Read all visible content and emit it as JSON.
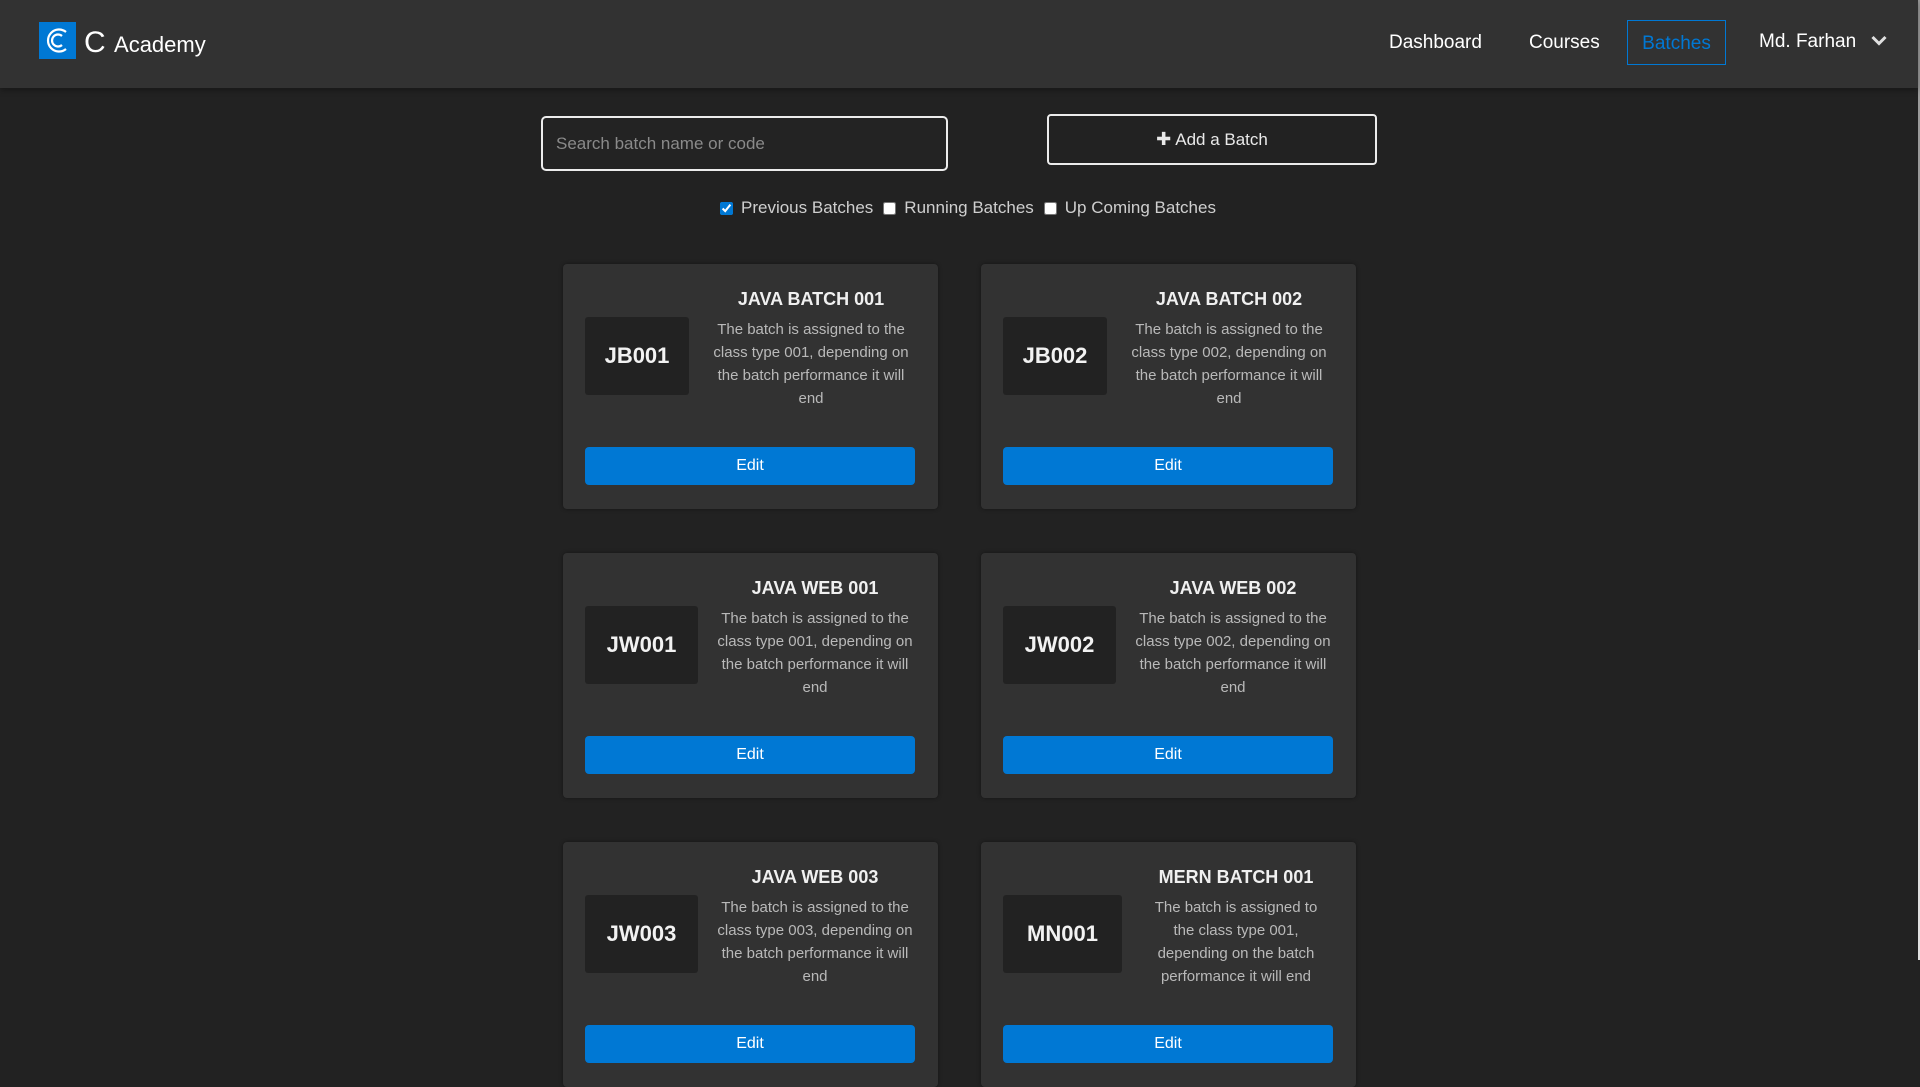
{
  "brand": {
    "name_big": "C",
    "name_small": "Academy",
    "color": "#0078d4"
  },
  "nav": {
    "dashboard": "Dashboard",
    "courses": "Courses",
    "batches": "Batches",
    "user": "Md. Farhan",
    "active": "Batches"
  },
  "search": {
    "placeholder": "Search batch name or code",
    "value": ""
  },
  "add_button": {
    "label": "Add a Batch",
    "icon": "plus-icon"
  },
  "filters": [
    {
      "label": "Previous Batches",
      "checked": true
    },
    {
      "label": "Running Batches",
      "checked": false
    },
    {
      "label": "Up Coming Batches",
      "checked": false
    }
  ],
  "cards": [
    {
      "code": "JB001",
      "title": "JAVA BATCH 001",
      "desc": "The batch is assigned to the class type 001, depending on the batch performance it will end",
      "edit": "Edit"
    },
    {
      "code": "JB002",
      "title": "JAVA BATCH 002",
      "desc": "The batch is assigned to the class type 002, depending on the batch performance it will end",
      "edit": "Edit"
    },
    {
      "code": "JW001",
      "title": "JAVA WEB 001",
      "desc": "The batch is assigned to the class type 001, depending on the batch performance it will end",
      "edit": "Edit"
    },
    {
      "code": "JW002",
      "title": "JAVA WEB 002",
      "desc": "The batch is assigned to the class type 002, depending on the batch performance it will end",
      "edit": "Edit"
    },
    {
      "code": "JW003",
      "title": "JAVA WEB 003",
      "desc": "The batch is assigned to the class type 003, depending on the batch performance it will end",
      "edit": "Edit"
    },
    {
      "code": "MN001",
      "title": "MERN BATCH 001",
      "desc": "The batch is assigned to the class type 001, depending on the batch performance it will end",
      "edit": "Edit"
    }
  ]
}
